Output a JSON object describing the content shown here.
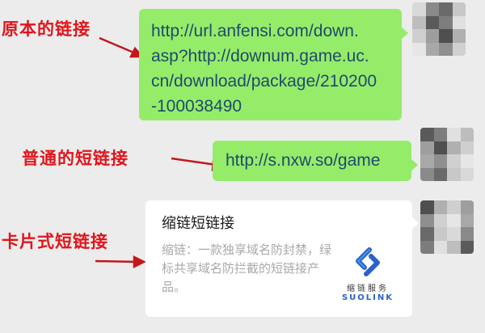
{
  "annotations": {
    "original_link": "原本的链接",
    "plain_short_link": "普通的短链接",
    "card_short_link": "卡片式短链接"
  },
  "messages": {
    "original_url_lines": [
      "http://url.anfensi.com/down.",
      "asp?http://downum.game.uc.",
      "cn/download/package/210200",
      "-100038490"
    ],
    "short_url": "http://s.nxw.so/game",
    "card": {
      "title": "缩链短链接",
      "description": "缩链：一款独享域名防封禁，绿标共享域名防拦截的短链接产品。",
      "logo_cn": "缩链服务",
      "logo_en": "SUOLINK"
    }
  },
  "colors": {
    "annotation": "#e0151b",
    "bubble_green": "#95ec69",
    "link_text": "#1f4a6e",
    "logo_blue": "#2a62c9"
  },
  "icons": {
    "avatar": "pixelated-avatar",
    "logo": "suolink-logo-icon"
  }
}
